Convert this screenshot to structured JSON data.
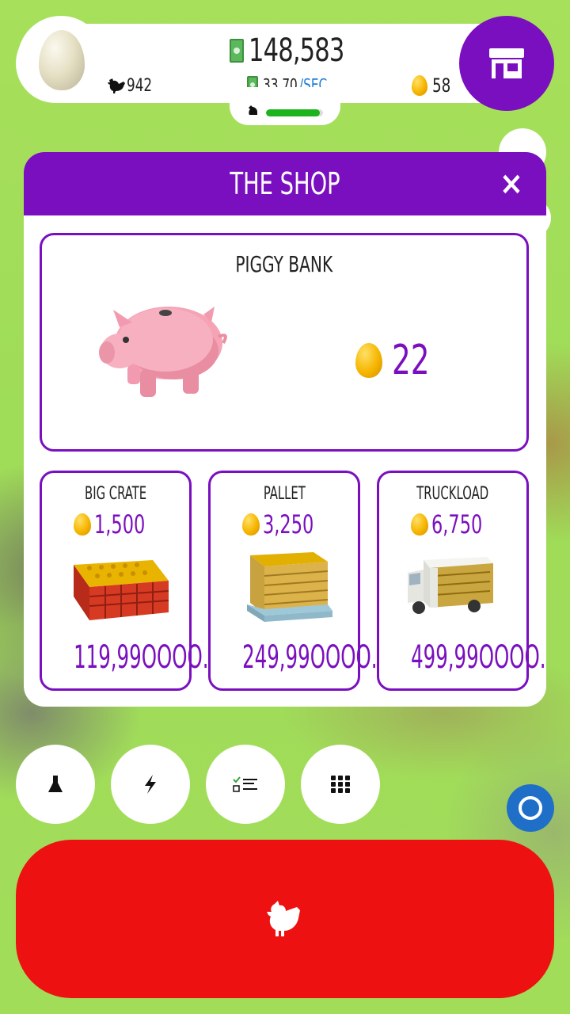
{
  "hud": {
    "cash": "148,583",
    "rate_value": "33.70",
    "rate_unit": "/SEC",
    "chickens": "942",
    "golden_eggs": "58",
    "progress": 0.95,
    "icons": {
      "egg": "egg-icon",
      "chicken": "chicken-icon",
      "cash": "cash-icon",
      "gold_egg": "golden-egg-icon",
      "shop": "shop-icon"
    }
  },
  "shop": {
    "title": "THE SHOP",
    "close_label": "×",
    "featured": {
      "title": "PIGGY BANK",
      "price": "22",
      "icon": "piggy-bank-icon"
    },
    "items": [
      {
        "title": "BIG CRATE",
        "eggs": "1,500",
        "price": "119,99ОООО.",
        "icon": "crate-icon"
      },
      {
        "title": "PALLET",
        "eggs": "3,250",
        "price": "249,99ОООО.",
        "icon": "pallet-icon"
      },
      {
        "title": "TRUCKLOAD",
        "eggs": "6,750",
        "price": "499,99ОООО.",
        "icon": "truck-icon"
      }
    ]
  },
  "bottom": {
    "buttons": [
      "research-icon",
      "boost-icon",
      "checklist-icon",
      "grid-menu-icon"
    ],
    "action_icon": "chicken-icon"
  },
  "colors": {
    "accent": "#7a0fbf",
    "action": "#ee1111",
    "background": "#a2dd5a",
    "progress": "#1db31d",
    "blue": "#1f6fc9"
  }
}
